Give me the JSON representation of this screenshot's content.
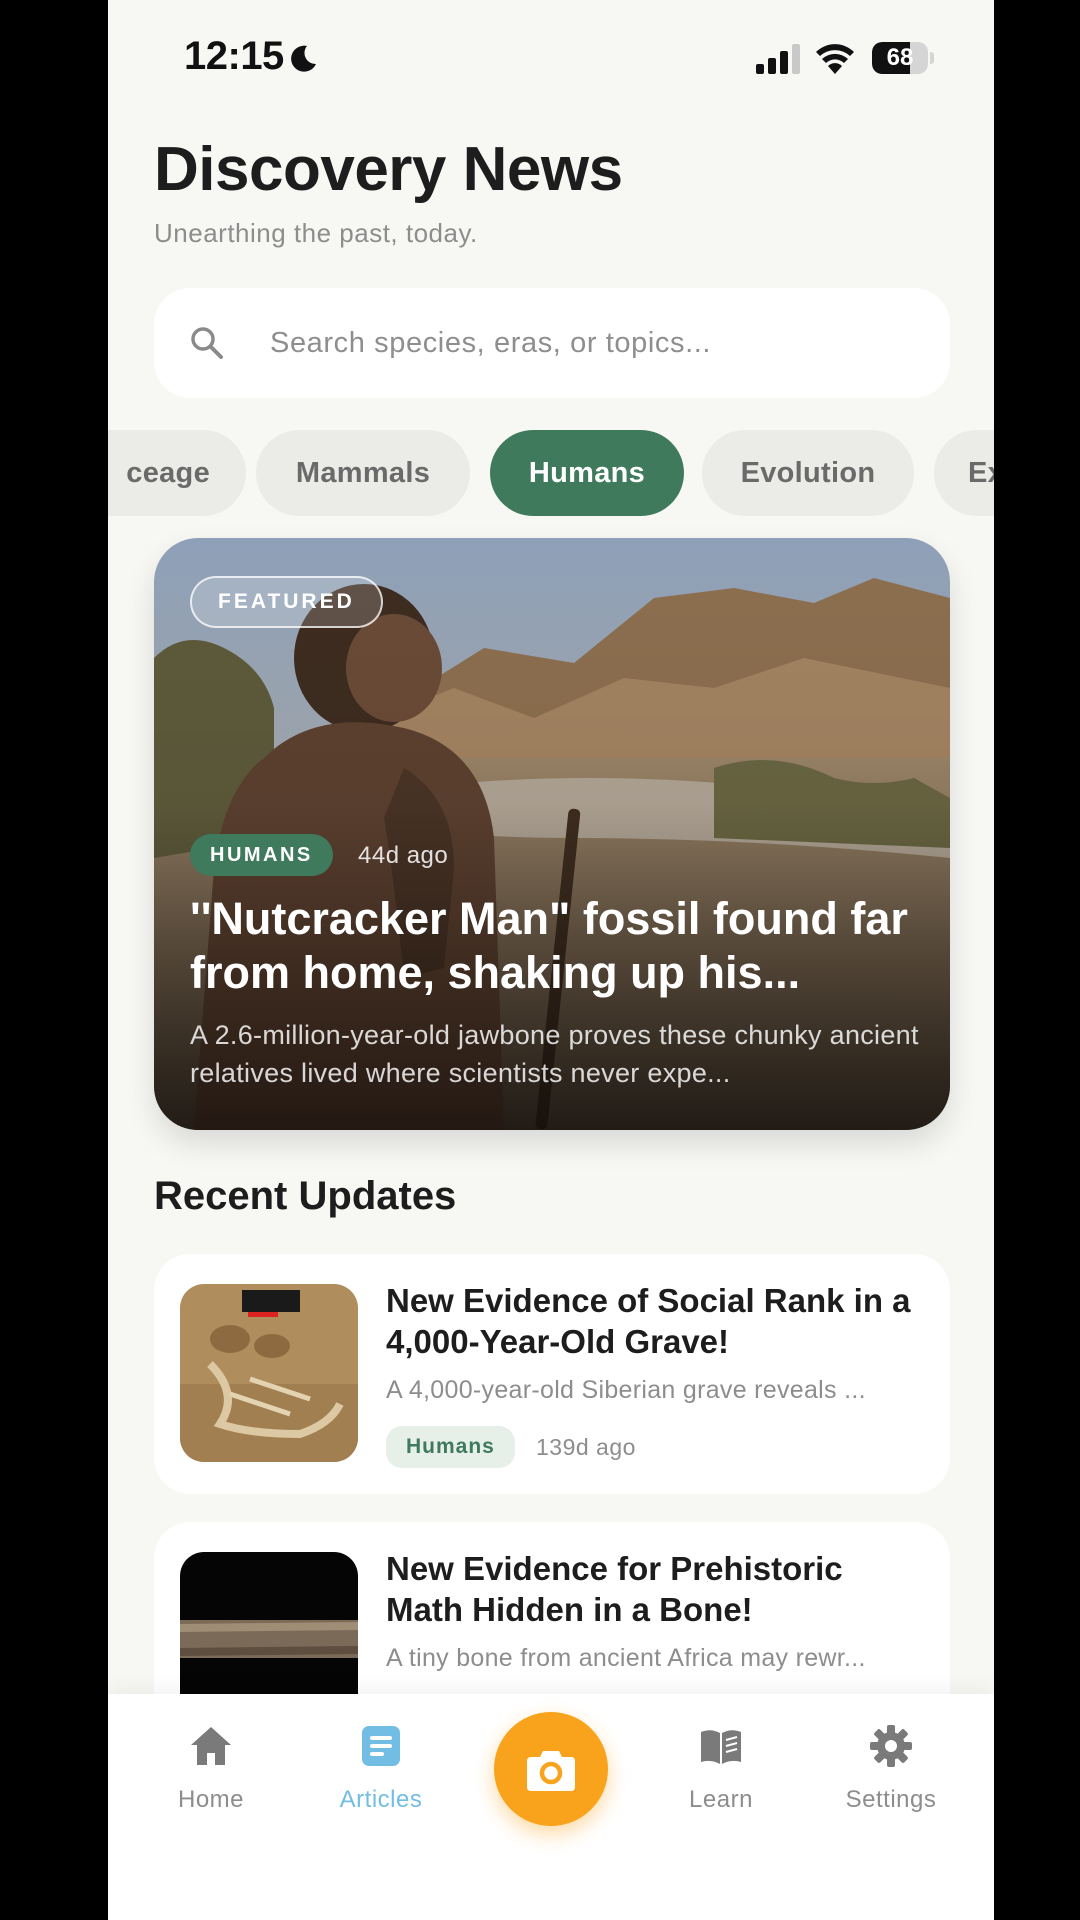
{
  "status_bar": {
    "time": "12:15",
    "battery": "68",
    "battery_level": 0.68
  },
  "header": {
    "title": "Discovery News",
    "subtitle": "Unearthing the past, today."
  },
  "search": {
    "placeholder": "Search species, eras, or topics...",
    "value": ""
  },
  "categories": [
    {
      "label": "Iceage",
      "visible_text": "ceage",
      "active": false
    },
    {
      "label": "Mammals",
      "active": false
    },
    {
      "label": "Humans",
      "active": true
    },
    {
      "label": "Evolution",
      "active": false
    },
    {
      "label": "Ex",
      "active": false
    }
  ],
  "featured": {
    "badge": "FEATURED",
    "tag": "HUMANS",
    "time": "44d ago",
    "title": "''Nutcracker Man\" fossil found far from home, shaking up his...",
    "description": "A 2.6-million-year-old jawbone proves these chunky ancient relatives lived where scientists never expe..."
  },
  "recent": {
    "title": "Recent Updates",
    "articles": [
      {
        "title": "New Evidence of Social Rank in a 4,000-Year-Old Grave!",
        "description": "A 4,000-year-old Siberian grave reveals ...",
        "tag": "Humans",
        "time": "139d ago"
      },
      {
        "title": "New Evidence for Prehistoric Math Hidden in a Bone!",
        "description": "A tiny bone from ancient Africa may rewr..."
      }
    ]
  },
  "tab_bar": {
    "tabs": [
      {
        "label": "Home",
        "icon": "home-icon",
        "active": false
      },
      {
        "label": "Articles",
        "icon": "articles-icon",
        "active": true
      },
      {
        "label": "Learn",
        "icon": "book-icon",
        "active": false
      },
      {
        "label": "Settings",
        "icon": "gear-icon",
        "active": false
      }
    ],
    "camera_icon": "camera-icon"
  },
  "colors": {
    "accent_green": "#3f7a5c",
    "camera_orange": "#f9a21b",
    "active_tab_blue": "#72bde4",
    "background": "#f7f7f4"
  }
}
